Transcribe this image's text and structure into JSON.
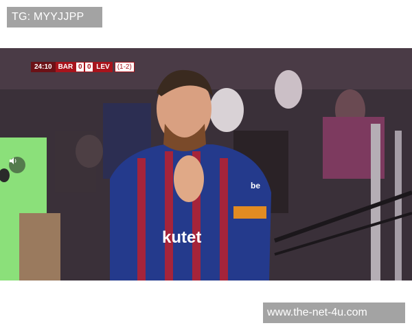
{
  "top_tag": {
    "text": "TG: MYYJJPP"
  },
  "scorebug": {
    "time": "24:10",
    "home_team": "BAR",
    "home_score": "0",
    "away_score": "0",
    "away_team": "LEV",
    "aggregate": "(1-2)"
  },
  "video": {
    "mute_icon": "speaker-icon",
    "sponsor_text": "kutet",
    "sleeve_text": "be"
  },
  "bottom_watermark": {
    "text": "www.the-net-4u.com"
  }
}
